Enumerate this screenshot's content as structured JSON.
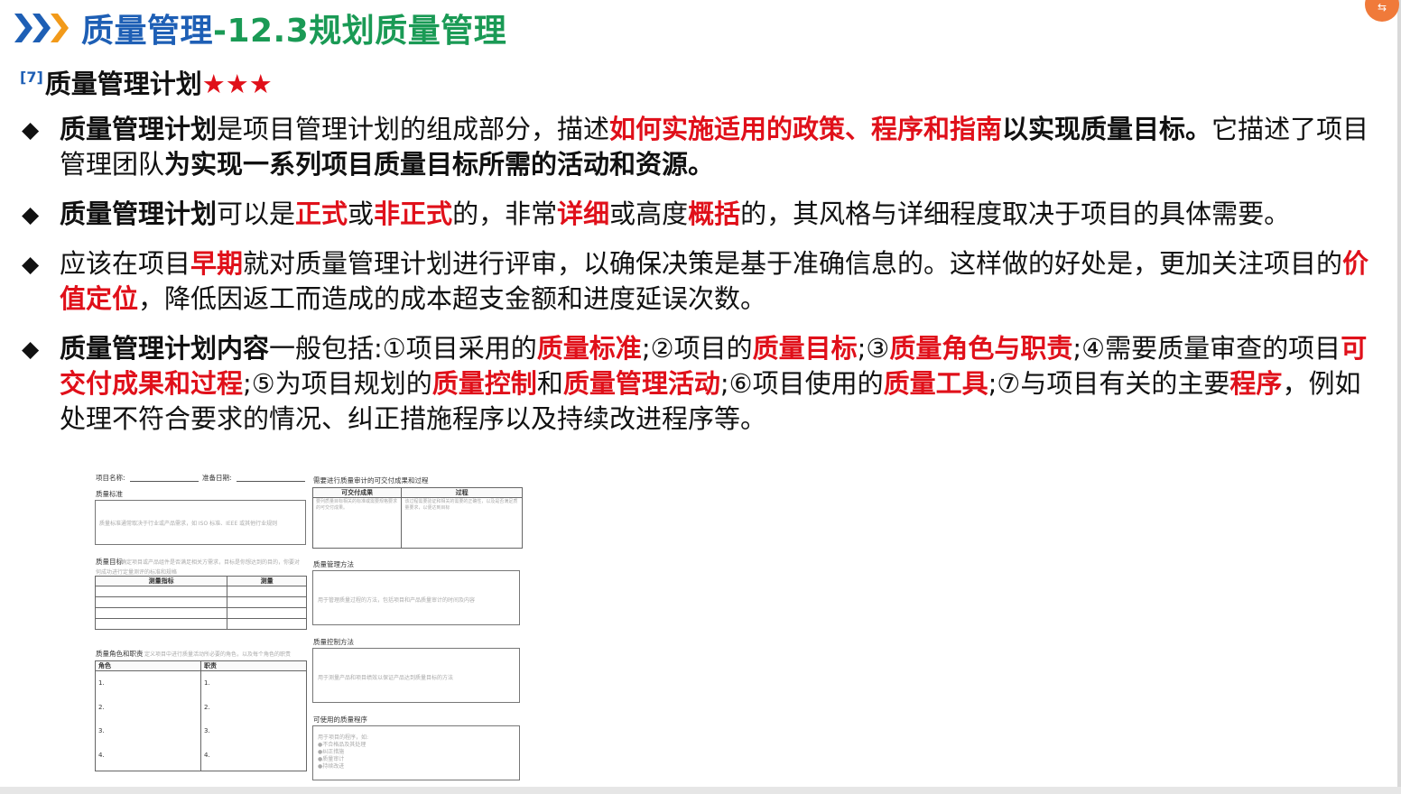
{
  "header": {
    "title_part1": "质量管理",
    "title_part2": "-12.3规划质量管理"
  },
  "subheading": {
    "ref": "[7]",
    "text": "质量管理计划",
    "stars": "★★★"
  },
  "bullets": [
    {
      "segments": [
        {
          "t": "质量管理计划",
          "s": "b"
        },
        {
          "t": "是项目管理计划的组成部分，描述",
          "s": ""
        },
        {
          "t": "如何实施适用的政策、程序和指南",
          "s": "red"
        },
        {
          "t": "以实现质量目标。",
          "s": "b"
        },
        {
          "t": "它描述了项目管理团队",
          "s": ""
        },
        {
          "t": "为实现一系列项目质量目标所需的活动和资源。",
          "s": "b"
        }
      ]
    },
    {
      "segments": [
        {
          "t": "质量管理计划",
          "s": "b"
        },
        {
          "t": "可以是",
          "s": ""
        },
        {
          "t": "正式",
          "s": "red"
        },
        {
          "t": "或",
          "s": ""
        },
        {
          "t": "非正式",
          "s": "red"
        },
        {
          "t": "的，非常",
          "s": ""
        },
        {
          "t": "详细",
          "s": "red"
        },
        {
          "t": "或高度",
          "s": ""
        },
        {
          "t": "概括",
          "s": "red"
        },
        {
          "t": "的，其风格与详细程度取决于项目的具体需要。",
          "s": ""
        }
      ]
    },
    {
      "segments": [
        {
          "t": "应该在项目",
          "s": ""
        },
        {
          "t": "早期",
          "s": "red"
        },
        {
          "t": "就对质量管理计划进行评审，以确保决策是基于准确信息的。这样做的好处是，更加关注项目的",
          "s": ""
        },
        {
          "t": "价值定位",
          "s": "red"
        },
        {
          "t": "，降低因返工而造成的成本超支金额和进度延误次数。",
          "s": ""
        }
      ]
    },
    {
      "segments": [
        {
          "t": "质量管理计划内容",
          "s": "b"
        },
        {
          "t": "一般包括:①项目采用的",
          "s": ""
        },
        {
          "t": "质量标准",
          "s": "red"
        },
        {
          "t": ";②项目的",
          "s": ""
        },
        {
          "t": "质量目标",
          "s": "red"
        },
        {
          "t": ";③",
          "s": ""
        },
        {
          "t": "质量角色与职责",
          "s": "red"
        },
        {
          "t": ";④需要质量审查的项目",
          "s": ""
        },
        {
          "t": "可交付成果和过程",
          "s": "red"
        },
        {
          "t": ";⑤为项目规划的",
          "s": ""
        },
        {
          "t": "质量控制",
          "s": "red"
        },
        {
          "t": "和",
          "s": ""
        },
        {
          "t": "质量管理活动",
          "s": "red"
        },
        {
          "t": ";⑥项目使用的",
          "s": ""
        },
        {
          "t": "质量工具",
          "s": "red"
        },
        {
          "t": ";⑦与项目有关的主要",
          "s": ""
        },
        {
          "t": "程序",
          "s": "red"
        },
        {
          "t": "，例如处理不符合要求的情况、纠正措施程序以及持续改进程序等。",
          "s": ""
        }
      ]
    }
  ],
  "form": {
    "project_name": "项目名称:",
    "prep_date": "准备日期:",
    "quality_standards": "质量标准",
    "quality_standards_hint": "质量标准通常取决于行业或产品需求，如 ISO 标准、IEEE 或其他行业规则",
    "quality_objectives": "质量目标",
    "quality_objectives_hint": "确定项目或产品组件是否满足相关方需求，目标是你想达到的目的，你要对",
    "quality_objectives_hint2": "何成功进行定量测评的标准和规格",
    "metric_col": "测量指标",
    "measure_col": "测量",
    "roles_title": "质量角色和职责",
    "roles_hint": "定义项目中进行质量活动所必要的角色，以及每个角色的职责",
    "role_col": "角色",
    "duty_col": "职责",
    "role_nums": [
      "1.",
      "2.",
      "3.",
      "4."
    ],
    "review_title": "需要进行质量审计的可交付成果和过程",
    "deliverables_col": "可交付成果",
    "process_col": "过程",
    "deliverables_hint": "要列质量目标相关的标准或需要规格要求的可交付成果。",
    "process_hint": "该过程需要验证和相关的需要的正确性，以及是否满足质量要求，以便达到目标",
    "mgmt_method": "质量管理方法",
    "mgmt_hint": "用于管理质量过程的方法，包括项目和产品质量审计的时间及内容",
    "control_method": "质量控制方法",
    "control_hint": "用于测量产品和项目绩效以保证产品达到质量目标的方法",
    "procedures": "可使用的质量程序",
    "procedures_hint": "用于项目的程序，如:",
    "procedures_items": [
      "●不合格品及其处理",
      "●纠正措施",
      "●质量审计",
      "●持续改进"
    ]
  }
}
